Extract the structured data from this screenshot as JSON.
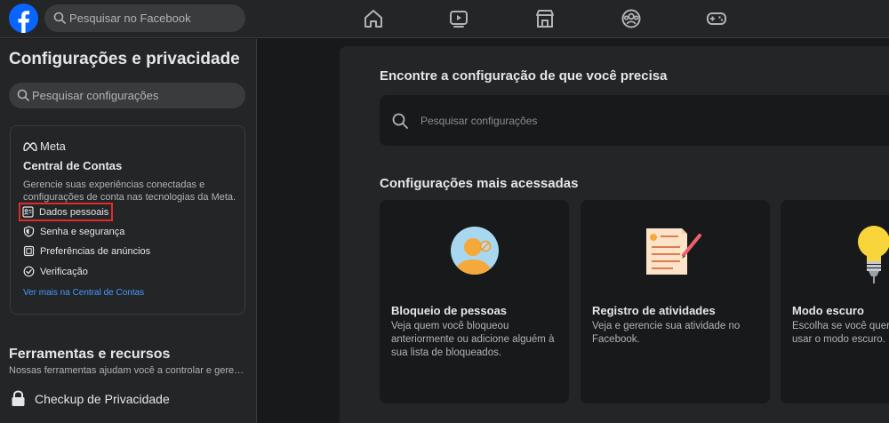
{
  "topbar": {
    "search_placeholder": "Pesquisar no Facebook",
    "nav_icons": [
      "home-icon",
      "video-icon",
      "marketplace-icon",
      "groups-icon",
      "gaming-icon"
    ]
  },
  "sidebar": {
    "title": "Configurações e privacidade",
    "search_placeholder": "Pesquisar configurações",
    "accounts_center": {
      "brand": "Meta",
      "title": "Central de Contas",
      "description": "Gerencie suas experiências conectadas e configurações de conta nas tecnologias da Meta.",
      "items": [
        {
          "label": "Dados pessoais",
          "icon": "id-card-icon",
          "highlighted": true
        },
        {
          "label": "Senha e segurança",
          "icon": "shield-icon"
        },
        {
          "label": "Preferências de anúncios",
          "icon": "ad-preferences-icon"
        },
        {
          "label": "Verificação",
          "icon": "check-circle-icon"
        }
      ],
      "link": "Ver mais na Central de Contas"
    },
    "tools": {
      "title": "Ferramentas e recursos",
      "description": "Nossas ferramentas ajudam você a controlar e gerenciar sua privacidade.",
      "checkup_label": "Checkup de Privacidade"
    }
  },
  "main": {
    "title": "Encontre a configuração de que você precisa",
    "search_placeholder": "Pesquisar configurações",
    "section_title": "Configurações mais acessadas",
    "cards": [
      {
        "title": "Bloqueio de pessoas",
        "description": "Veja quem você bloqueou anteriormente ou adicione alguém à sua lista de bloqueados."
      },
      {
        "title": "Registro de atividades",
        "description": "Veja e gerencie sua atividade no Facebook."
      },
      {
        "title": "Modo escuro",
        "description": "Escolha se você quer usar o modo escuro."
      }
    ]
  },
  "colors": {
    "background": "#18191a",
    "panel": "#242526",
    "accent": "#0866ff",
    "link": "#4599ff",
    "highlight": "#e22a2a"
  }
}
